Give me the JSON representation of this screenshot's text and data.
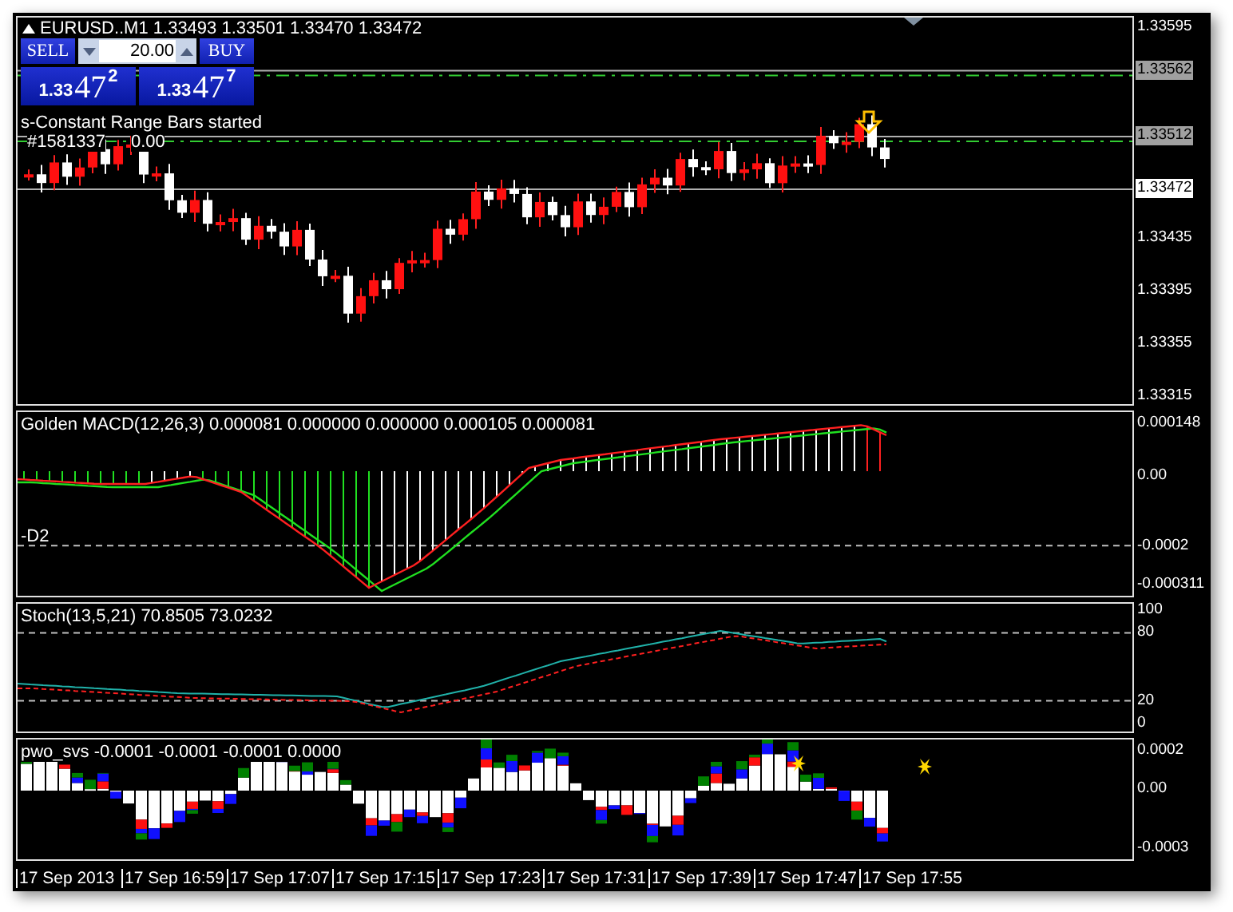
{
  "chart_header": {
    "title": "EURUSD..M1 1.33493 1.33501 1.33470 1.33472"
  },
  "trade_panel": {
    "sell_label": "SELL",
    "buy_label": "BUY",
    "lots": "20.00",
    "sell_price": {
      "big": "1.33",
      "pips": "47",
      "fraction": "2"
    },
    "buy_price": {
      "big": "1.33",
      "pips": "47",
      "fraction": "7"
    }
  },
  "messages": {
    "status": "s-Constant Range Bars started",
    "ticket": "#1581337",
    "lots": "0.00"
  },
  "price_axis": [
    {
      "label": "1.33595",
      "kind": "tick"
    },
    {
      "label": "1.33562",
      "kind": "marker"
    },
    {
      "label": "1.33512",
      "kind": "marker"
    },
    {
      "label": "1.33472",
      "kind": "current"
    },
    {
      "label": "1.33435",
      "kind": "tick"
    },
    {
      "label": "1.33395",
      "kind": "tick"
    },
    {
      "label": "1.33355",
      "kind": "tick"
    },
    {
      "label": "1.33315",
      "kind": "tick"
    }
  ],
  "indicators": [
    {
      "kind": "macd",
      "title": "Golden MACD(12,26,3) 0.000081 0.000000 0.000000 0.000105 0.000081",
      "level_label": "-D2",
      "axis": [
        "0.000148",
        "0.00",
        "-0.0002",
        "-0.000311"
      ]
    },
    {
      "kind": "stoch",
      "title": "Stoch(13,5,21) 70.8505 73.0232",
      "axis": [
        "100",
        "80",
        "20",
        "0"
      ]
    },
    {
      "kind": "pwo",
      "title": "pwo_svs -0.0001 -0.0001 -0.0001 0.0000",
      "axis": [
        "0.0002",
        "0.00",
        "-0.0003"
      ]
    }
  ],
  "time_axis": [
    "17 Sep 2013",
    "17 Sep 16:59",
    "17 Sep 17:07",
    "17 Sep 17:15",
    "17 Sep 17:23",
    "17 Sep 17:31",
    "17 Sep 17:39",
    "17 Sep 17:47",
    "17 Sep 17:55"
  ]
}
